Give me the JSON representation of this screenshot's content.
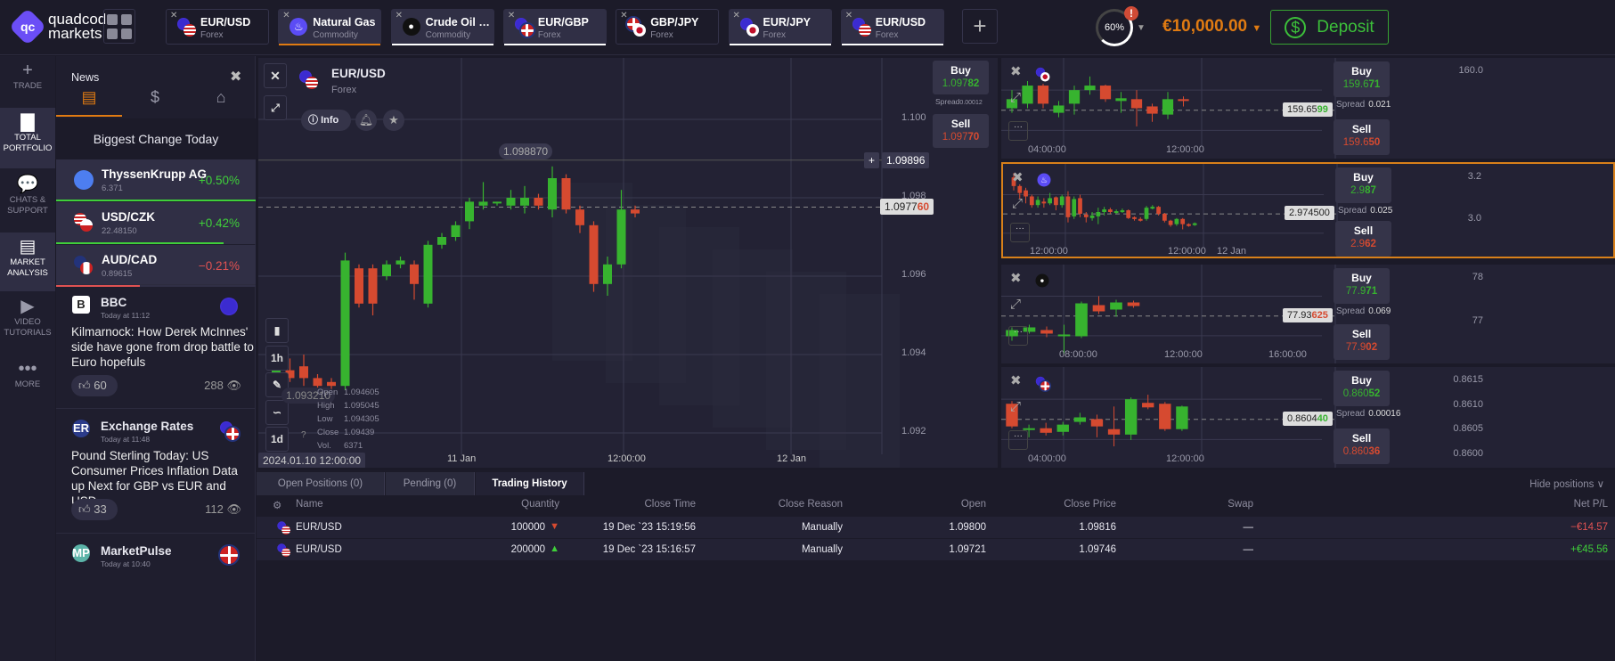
{
  "brand": {
    "line1": "quadcode",
    "line2": "markets"
  },
  "tabs": [
    {
      "name": "EUR/USD",
      "type": "Forex",
      "icon": "eur-usd-flags",
      "filled": false
    },
    {
      "name": "Natural Gas",
      "type": "Commodity",
      "icon": "flame-icon",
      "filled": true,
      "underline": "#e07b12"
    },
    {
      "name": "Crude Oil Br...",
      "type": "Commodity",
      "icon": "oil-drop-icon",
      "filled": true,
      "underline": "#ffffff"
    },
    {
      "name": "EUR/GBP",
      "type": "Forex",
      "icon": "eur-gbp-flags",
      "filled": true,
      "underline": "#ffffff"
    },
    {
      "name": "GBP/JPY",
      "type": "Forex",
      "icon": "gbp-jpy-flags",
      "filled": false
    },
    {
      "name": "EUR/JPY",
      "type": "Forex",
      "icon": "eur-jpy-flags",
      "filled": true,
      "underline": "#ffffff"
    },
    {
      "name": "EUR/USD",
      "type": "Forex",
      "icon": "eur-usd-flags",
      "filled": true,
      "underline": "#ffffff"
    }
  ],
  "header": {
    "margin_level": "60%",
    "balance": "€10,000.00",
    "deposit": "Deposit"
  },
  "nav": [
    {
      "l1": "TRADE",
      "l2": "",
      "icon": "+"
    },
    {
      "l1": "TOTAL",
      "l2": "PORTFOLIO",
      "icon": "▇",
      "active": true
    },
    {
      "l1": "CHATS &",
      "l2": "SUPPORT",
      "icon": "💬"
    },
    {
      "l1": "MARKET",
      "l2": "ANALYSIS",
      "icon": "▤",
      "active": true
    },
    {
      "l1": "VIDEO",
      "l2": "TUTORIALS",
      "icon": "▶"
    },
    {
      "l1": "MORE",
      "l2": "",
      "icon": "•••"
    }
  ],
  "news": {
    "title": "News",
    "biggest": "Biggest Change Today",
    "movers": [
      {
        "name": "ThyssenKrupp AG",
        "price": "6.371",
        "change": "+0.50%",
        "up": true,
        "bar": 100
      },
      {
        "name": "USD/CZK",
        "price": "22.48150",
        "change": "+0.42%",
        "up": true,
        "bar": 84
      },
      {
        "name": "AUD/CAD",
        "price": "0.89615",
        "change": "−0.21%",
        "up": false,
        "bar": 42
      }
    ],
    "items": [
      {
        "source": "BBC",
        "time": "Today at 11:12",
        "headline": "Kilmarnock: How Derek McInnes' side have gone from drop battle to Euro hopefuls",
        "likes": "60",
        "views": "288"
      },
      {
        "source": "Exchange Rates",
        "time": "Today at 11:48",
        "headline": "Pound Sterling Today: US Consumer Prices Inflation Data up Next for GBP vs EUR and USD",
        "likes": "33",
        "views": "112"
      },
      {
        "source": "MarketPulse",
        "time": "Today at 10:40",
        "headline": "",
        "likes": "",
        "views": ""
      }
    ]
  },
  "main": {
    "symbol": "EUR/USD",
    "type": "Forex",
    "info": "Info",
    "buy": {
      "label": "Buy",
      "a": "1.097",
      "b": "82"
    },
    "spread_label": "Spread",
    "spread": "0.00012",
    "sell": {
      "label": "Sell",
      "a": "1.097",
      "b": "70"
    },
    "crosshair": "1.09896",
    "current": {
      "a": "1.0977",
      "b": "60"
    },
    "hover_price": "1.098870",
    "low_price": "1.093210",
    "yticks": [
      "1.100",
      "1.098",
      "1.096",
      "1.094",
      "1.092"
    ],
    "xticks": [
      "11 Jan",
      "12:00:00",
      "12 Jan"
    ],
    "cursor_time": "2024.01.10 12:00:00",
    "ohlc": {
      "open_l": "Open",
      "open": "1.094605",
      "high_l": "High",
      "high": "1.095045",
      "low_l": "Low",
      "low": "1.094305",
      "close_l": "Close",
      "close": "1.09439",
      "vol_l": "Vol.",
      "vol": "6371"
    },
    "intervals": [
      "1h",
      "1d"
    ],
    "candles": [
      [
        1.0934,
        1.0936,
        1.0932,
        1.0937
      ],
      [
        1.0936,
        1.0934,
        1.0933,
        1.0939
      ],
      [
        1.0937,
        1.0934,
        1.0932,
        1.094
      ],
      [
        1.0934,
        1.0932,
        1.0931,
        1.0935
      ],
      [
        1.0933,
        1.0932,
        1.0928,
        1.0934
      ],
      [
        1.0932,
        1.0964,
        1.0931,
        1.0966
      ],
      [
        1.0962,
        1.0953,
        1.0952,
        1.0963
      ],
      [
        1.0962,
        1.0953,
        1.095,
        1.0963
      ],
      [
        1.096,
        1.0963,
        1.0959,
        1.0964
      ],
      [
        1.0963,
        1.0964,
        1.0962,
        1.0965
      ],
      [
        1.0963,
        1.0958,
        1.0954,
        1.0964
      ],
      [
        1.0953,
        1.0968,
        1.0952,
        1.0969
      ],
      [
        1.0968,
        1.097,
        1.0967,
        1.0971
      ],
      [
        1.097,
        1.0973,
        1.0969,
        1.0974
      ],
      [
        1.0974,
        1.0979,
        1.0972,
        1.098
      ],
      [
        1.0978,
        1.0979,
        1.0977,
        1.0984
      ],
      [
        1.0979,
        1.0979,
        1.0978,
        1.0979
      ],
      [
        1.0978,
        1.098,
        1.0977,
        1.0982
      ],
      [
        1.0978,
        1.098,
        1.0976,
        1.0983
      ],
      [
        1.098,
        1.0978,
        1.0977,
        1.0981
      ],
      [
        1.0977,
        1.0985,
        1.0975,
        1.0988
      ],
      [
        1.0985,
        1.0977,
        1.0976,
        1.0986
      ],
      [
        1.0977,
        1.0973,
        1.0971,
        1.0978
      ],
      [
        1.0973,
        1.0958,
        1.0956,
        1.0974
      ],
      [
        1.0958,
        1.0963,
        1.0955,
        1.0965
      ],
      [
        1.0963,
        1.0977,
        1.0962,
        1.0982
      ],
      [
        1.0977,
        1.0976,
        1.0975,
        1.0978
      ]
    ]
  },
  "minis": [
    {
      "icon": "eur-jpy-flags",
      "yticks": [
        "160.0"
      ],
      "xticks": [
        "04:00:00",
        "12:00:00"
      ],
      "current": {
        "a": "159.65",
        "b": "99"
      },
      "buy": {
        "a": "159.6",
        "b": "71"
      },
      "sell": {
        "a": "159.6",
        "b": "50"
      },
      "spread": "0.021",
      "spread_label": "Spread",
      "selected": false,
      "candles": [
        [
          0.5,
          0.6,
          0.45,
          0.7
        ],
        [
          0.55,
          0.75,
          0.5,
          0.8
        ],
        [
          0.75,
          0.55,
          0.5,
          0.77
        ],
        [
          0.45,
          0.53,
          0.4,
          0.58
        ],
        [
          0.55,
          0.7,
          0.43,
          0.75
        ],
        [
          0.7,
          0.75,
          0.65,
          0.85
        ],
        [
          0.75,
          0.6,
          0.57,
          0.76
        ],
        [
          0.58,
          0.61,
          0.45,
          0.68
        ],
        [
          0.6,
          0.5,
          0.3,
          0.7
        ],
        [
          0.52,
          0.44,
          0.35,
          0.55
        ],
        [
          0.43,
          0.6,
          0.38,
          0.68
        ],
        [
          0.6,
          0.58,
          0.52,
          0.63
        ]
      ]
    },
    {
      "icon": "flame-icon",
      "yticks": [
        "3.2",
        "3.0"
      ],
      "xticks": [
        "12:00:00",
        "12:00:00",
        "12 Jan"
      ],
      "current": {
        "a": "2.974500",
        "b": ""
      },
      "buy": {
        "a": "2.9",
        "b": "87"
      },
      "sell": {
        "a": "2.9",
        "b": "62"
      },
      "spread": "0.025",
      "spread_label": "Spread",
      "selected": true,
      "candles": [
        [
          0.9,
          0.8,
          0.75,
          0.95
        ],
        [
          0.8,
          0.72,
          0.65,
          0.82
        ],
        [
          0.75,
          0.68,
          0.6,
          0.78
        ],
        [
          0.68,
          0.58,
          0.55,
          0.7
        ],
        [
          0.58,
          0.64,
          0.55,
          0.68
        ],
        [
          0.62,
          0.6,
          0.55,
          0.66
        ],
        [
          0.6,
          0.66,
          0.58,
          0.72
        ],
        [
          0.67,
          0.58,
          0.52,
          0.68
        ],
        [
          0.58,
          0.68,
          0.55,
          0.7
        ],
        [
          0.68,
          0.44,
          0.38,
          0.74
        ],
        [
          0.45,
          0.65,
          0.42,
          0.68
        ],
        [
          0.66,
          0.48,
          0.44,
          0.7
        ],
        [
          0.47,
          0.44,
          0.38,
          0.5
        ],
        [
          0.43,
          0.46,
          0.4,
          0.5
        ],
        [
          0.45,
          0.5,
          0.36,
          0.55
        ],
        [
          0.5,
          0.53,
          0.46,
          0.56
        ],
        [
          0.53,
          0.5,
          0.48,
          0.55
        ],
        [
          0.5,
          0.51,
          0.48,
          0.53
        ],
        [
          0.51,
          0.52,
          0.49,
          0.54
        ],
        [
          0.52,
          0.43,
          0.42,
          0.53
        ],
        [
          0.44,
          0.42,
          0.4,
          0.45
        ],
        [
          0.42,
          0.41,
          0.39,
          0.44
        ],
        [
          0.42,
          0.55,
          0.4,
          0.57
        ],
        [
          0.54,
          0.56,
          0.53,
          0.58
        ],
        [
          0.56,
          0.48,
          0.46,
          0.57
        ],
        [
          0.48,
          0.4,
          0.38,
          0.49
        ],
        [
          0.4,
          0.35,
          0.33,
          0.41
        ],
        [
          0.36,
          0.42,
          0.34,
          0.43
        ],
        [
          0.42,
          0.36,
          0.3,
          0.43
        ],
        [
          0.36,
          0.35,
          0.33,
          0.37
        ],
        [
          0.35,
          0.37,
          0.34,
          0.38
        ]
      ]
    },
    {
      "icon": "oil-drop-icon",
      "yticks": [
        "78",
        "77"
      ],
      "xticks": [
        "08:00:00",
        "12:00:00",
        "16:00:00"
      ],
      "current": {
        "a": "77.93",
        "b": "625"
      },
      "buy": {
        "a": "77.9",
        "b": "71"
      },
      "sell": {
        "a": "77.9",
        "b": "02"
      },
      "spread": "0.069",
      "spread_label": "Spread",
      "selected": false,
      "candles": [
        [
          0.25,
          0.32,
          0.2,
          0.35
        ],
        [
          0.3,
          0.35,
          0.28,
          0.38
        ],
        [
          0.32,
          0.28,
          0.24,
          0.36
        ],
        [
          0.27,
          0.27,
          0.05,
          0.38
        ],
        [
          0.25,
          0.62,
          0.23,
          0.64
        ],
        [
          0.6,
          0.53,
          0.5,
          0.7
        ],
        [
          0.55,
          0.63,
          0.47,
          0.66
        ],
        [
          0.63,
          0.59,
          0.57,
          0.65
        ]
      ]
    },
    {
      "icon": "eur-gbp-flags",
      "yticks": [
        "0.8615",
        "0.8610",
        "0.8605",
        "0.8600"
      ],
      "xticks": [
        "04:00:00",
        "12:00:00"
      ],
      "current": {
        "a": "0.8604",
        "b": "40"
      },
      "buy": {
        "a": "0.860",
        "b": "52"
      },
      "sell": {
        "a": "0.860",
        "b": "36"
      },
      "spread": "0.00016",
      "spread_label": "Spread",
      "selected": false,
      "candles": [
        [
          0.65,
          0.4,
          0.38,
          0.68
        ],
        [
          0.38,
          0.38,
          0.28,
          0.42
        ],
        [
          0.38,
          0.33,
          0.3,
          0.44
        ],
        [
          0.34,
          0.42,
          0.3,
          0.45
        ],
        [
          0.45,
          0.5,
          0.42,
          0.55
        ],
        [
          0.48,
          0.4,
          0.28,
          0.53
        ],
        [
          0.37,
          0.31,
          0.18,
          0.62
        ],
        [
          0.31,
          0.7,
          0.25,
          0.72
        ],
        [
          0.66,
          0.61,
          0.59,
          0.75
        ],
        [
          0.65,
          0.37,
          0.35,
          0.67
        ],
        [
          0.37,
          0.62,
          0.35,
          0.63
        ]
      ]
    }
  ],
  "bottom": {
    "tabs": [
      "Open Positions (0)",
      "Pending (0)",
      "Trading History"
    ],
    "hide": "Hide positions",
    "columns": [
      "Name",
      "Quantity",
      "Close Time",
      "Close Reason",
      "Open",
      "Close Price",
      "Swap",
      "Net P/L"
    ],
    "rows": [
      {
        "name": "EUR/USD",
        "qty": "100000",
        "dir": "down",
        "close_time": "19 Dec `23 15:19:56",
        "reason": "Manually",
        "open": "1.09800",
        "close": "1.09816",
        "swap": "—",
        "pl": "−€14.57",
        "pl_up": false
      },
      {
        "name": "EUR/USD",
        "qty": "200000",
        "dir": "up",
        "close_time": "19 Dec `23 15:16:57",
        "reason": "Manually",
        "open": "1.09721",
        "close": "1.09746",
        "swap": "—",
        "pl": "+€45.56",
        "pl_up": true
      }
    ]
  },
  "colors": {
    "up": "#37b32f",
    "down": "#d64a30",
    "accent": "#e07b12",
    "brand": "#6b4ef6"
  }
}
